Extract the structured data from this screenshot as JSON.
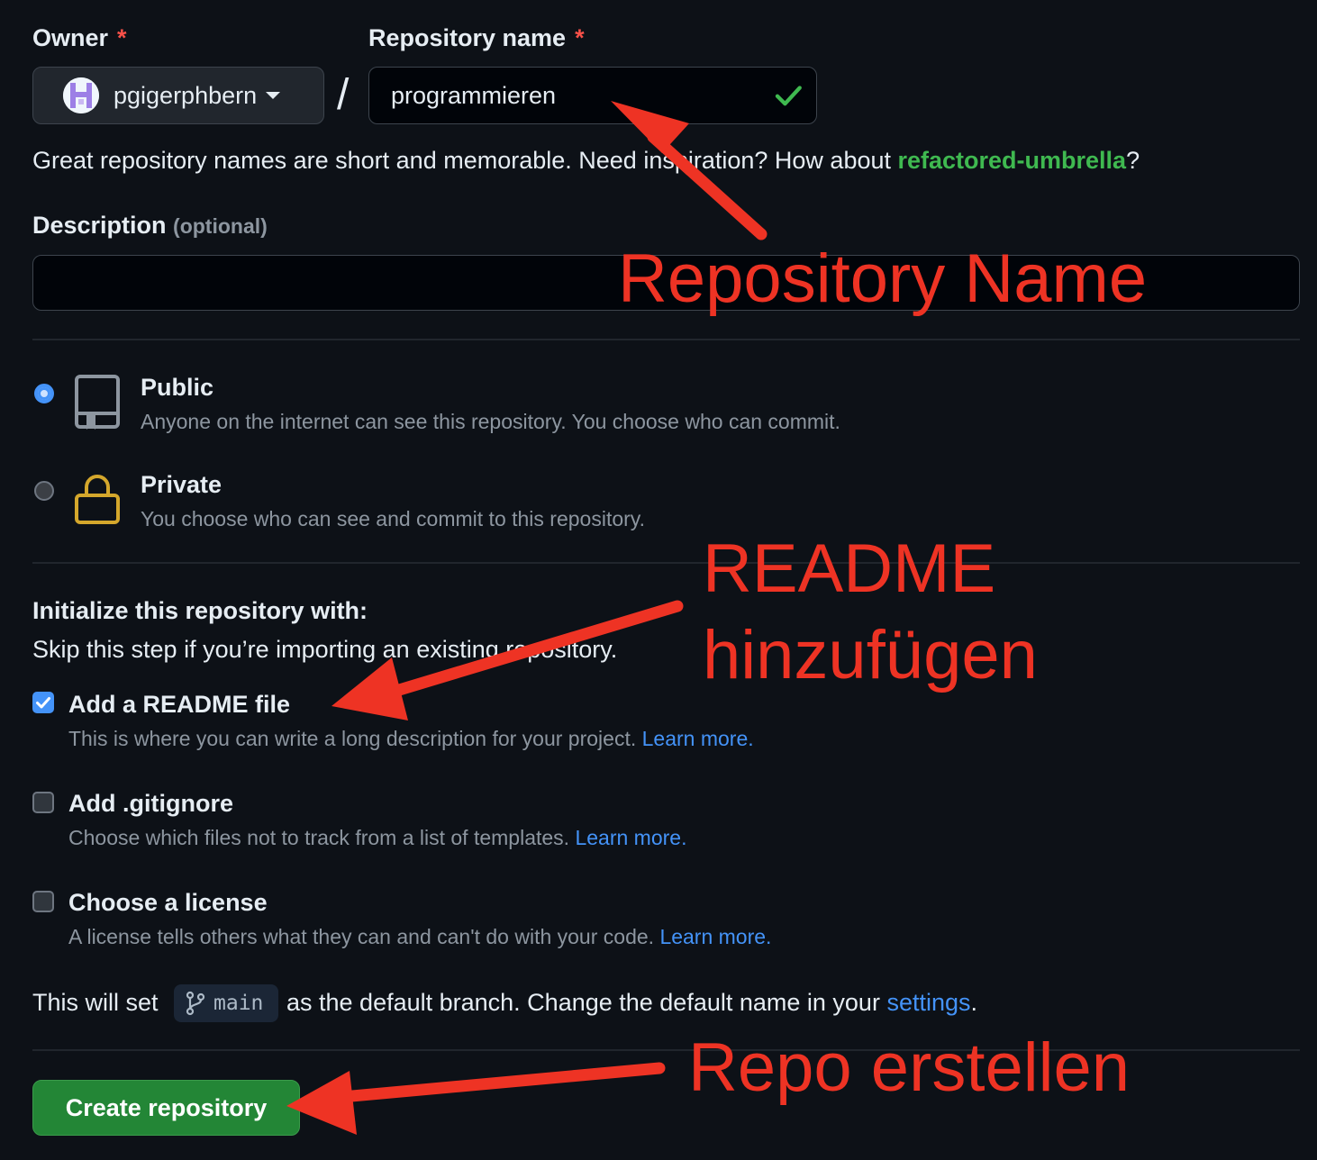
{
  "owner": {
    "label": "Owner",
    "required_mark": "*",
    "value": "pgigerphbern"
  },
  "separator": "/",
  "repo_name": {
    "label": "Repository name",
    "required_mark": "*",
    "value": "programmieren"
  },
  "hint": {
    "before": "Great repository names are short and memorable. Need inspiration? How about ",
    "suggestion": "refactored-umbrella",
    "after": "?"
  },
  "description": {
    "label": "Description",
    "optional": "(optional)",
    "value": ""
  },
  "visibility": {
    "public": {
      "title": "Public",
      "desc": "Anyone on the internet can see this repository. You choose who can commit.",
      "selected": true
    },
    "private": {
      "title": "Private",
      "desc": "You choose who can see and commit to this repository.",
      "selected": false
    }
  },
  "init": {
    "heading": "Initialize this repository with:",
    "subtext": "Skip this step if you’re importing an existing repository.",
    "readme": {
      "label": "Add a README file",
      "desc": "This is where you can write a long description for your project.",
      "link": "Learn more.",
      "checked": true
    },
    "gitignore": {
      "label": "Add .gitignore",
      "desc": "Choose which files not to track from a list of templates.",
      "link": "Learn more.",
      "checked": false
    },
    "license": {
      "label": "Choose a license",
      "desc": "A license tells others what they can and can't do with your code.",
      "link": "Learn more.",
      "checked": false
    }
  },
  "branch_note": {
    "before": "This will set",
    "branch": "main",
    "middle": "as the default branch. Change the default name in your",
    "link": "settings",
    "after": "."
  },
  "create_button": "Create repository",
  "annotations": {
    "repo_name": "Repository Name",
    "readme_line1": "README",
    "readme_line2": "hinzufügen",
    "create": "Repo erstellen"
  },
  "colors": {
    "annotation": "#ee3324",
    "link": "#4493f8",
    "success": "#3fb950",
    "button": "#238636"
  }
}
